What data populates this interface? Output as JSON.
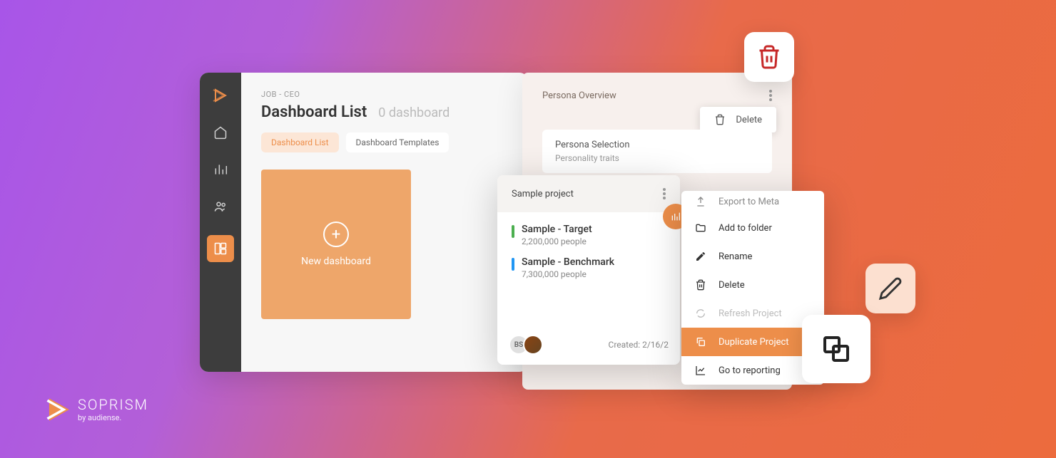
{
  "dashboard": {
    "breadcrumb": "JOB - CEO",
    "title": "Dashboard List",
    "subtitle": "0 dashboard",
    "tabs": {
      "list": "Dashboard List",
      "templates": "Dashboard Templates"
    },
    "new_card_label": "New dashboard"
  },
  "persona": {
    "title": "Persona Overview",
    "delete_label": "Delete",
    "section_title": "Persona Selection",
    "section_sub": "Personality traits"
  },
  "project": {
    "title": "Sample project",
    "target": {
      "name": "Sample - Target",
      "people": "2,200,000 people"
    },
    "benchmark": {
      "name": "Sample - Benchmark",
      "people": "7,300,000 people"
    },
    "avatar_initials": "BS",
    "created": "Created: 2/16/2"
  },
  "menu": {
    "export": "Export to Meta",
    "add_folder": "Add to folder",
    "rename": "Rename",
    "delete": "Delete",
    "refresh": "Refresh Project",
    "duplicate": "Duplicate Project",
    "reporting": "Go to reporting"
  },
  "brand": {
    "name": "SOPRISM",
    "by": "by audiense."
  }
}
